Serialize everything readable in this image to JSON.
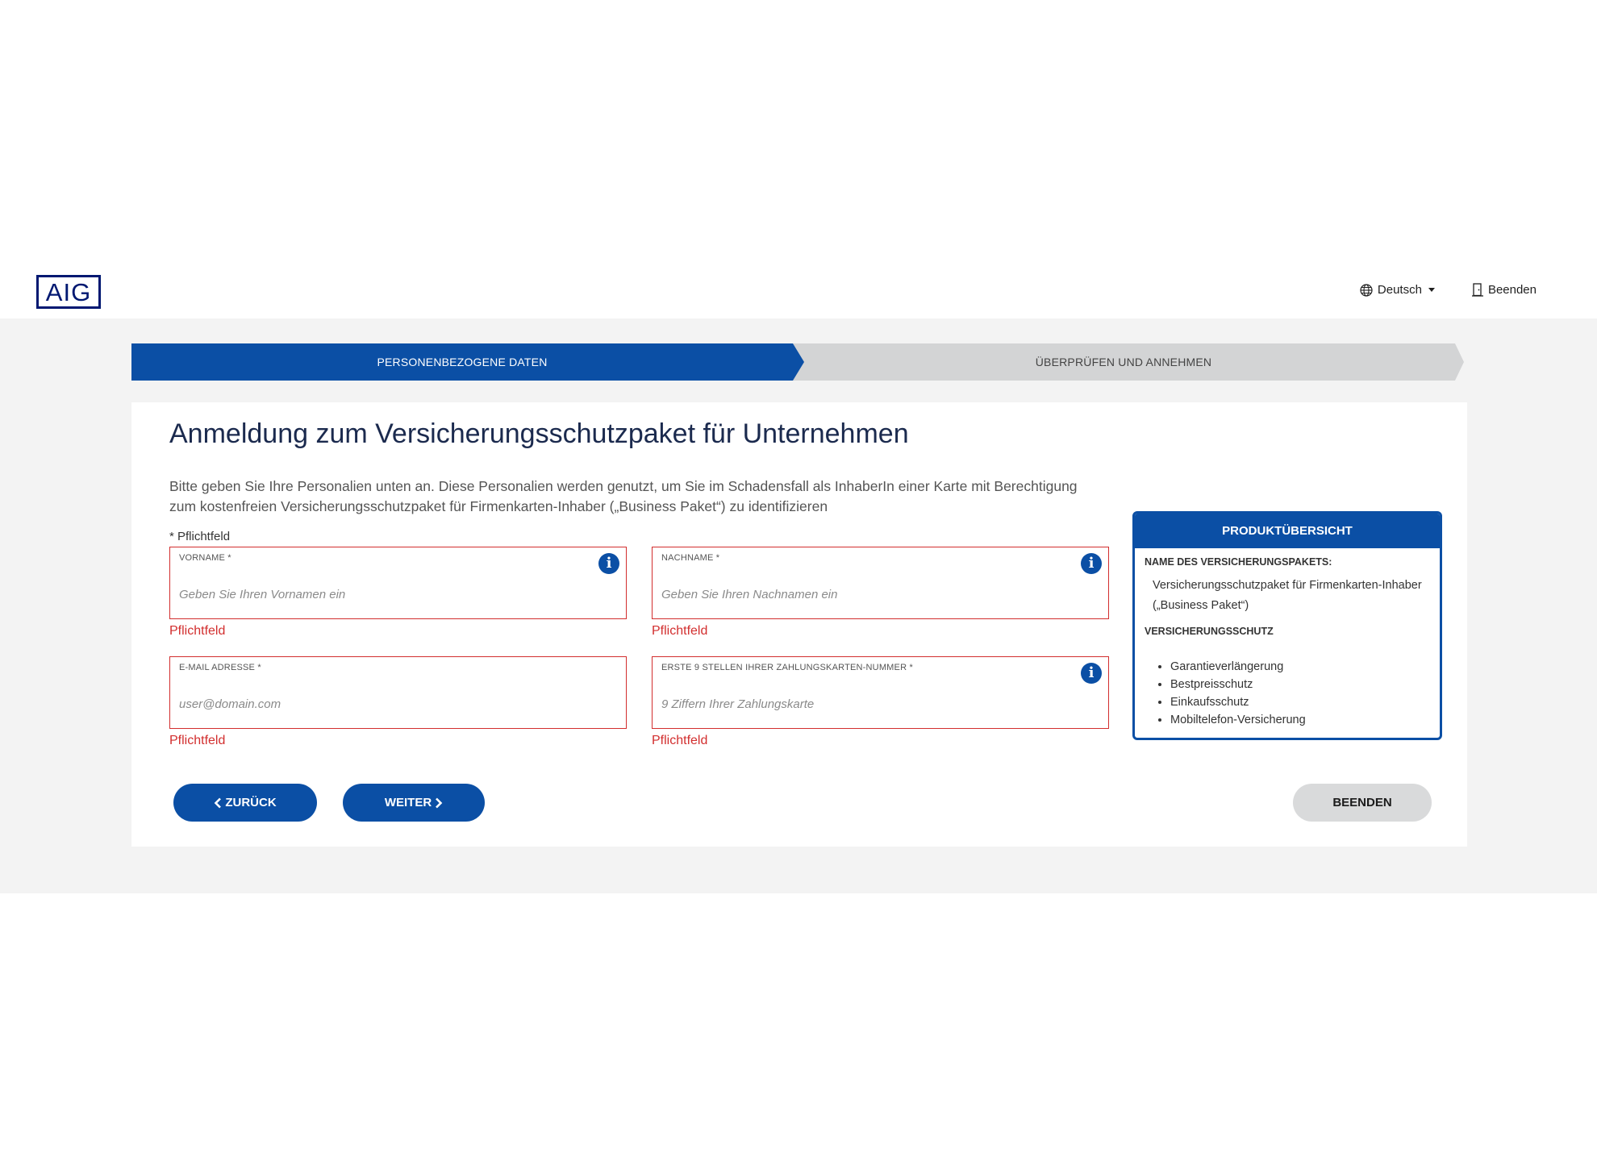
{
  "header": {
    "logo": "AIG",
    "language": "Deutsch",
    "exit": "Beenden"
  },
  "stepper": {
    "step1": "PERSONENBEZOGENE DATEN",
    "step2": "ÜBERPRÜFEN UND ANNEHMEN"
  },
  "form": {
    "title": "Anmeldung zum Versicherungsschutzpaket für Unternehmen",
    "intro": "Bitte geben Sie Ihre Personalien unten an. Diese Personalien werden genutzt, um Sie im Schadensfall als InhaberIn einer Karte mit Berechtigung zum kostenfreien Versicherungsschutzpaket für Firmenkarten-Inhaber („Business Paket“) zu identifizieren",
    "required_note": "* Pflichtfeld",
    "fields": {
      "firstname": {
        "label": "VORNAME *",
        "placeholder": "Geben Sie Ihren Vornamen ein",
        "value": "",
        "error": "Pflichtfeld"
      },
      "lastname": {
        "label": "NACHNAME *",
        "placeholder": "Geben Sie Ihren Nachnamen ein",
        "value": "",
        "error": "Pflichtfeld"
      },
      "email": {
        "label": "E-MAIL ADRESSE *",
        "placeholder": "user@domain.com",
        "value": "",
        "error": "Pflichtfeld"
      },
      "card": {
        "label": "ERSTE 9 STELLEN IHRER ZAHLUNGSKARTEN-NUMMER *",
        "placeholder": "9 Ziffern Ihrer Zahlungskarte",
        "value": "",
        "error": "Pflichtfeld"
      }
    },
    "buttons": {
      "back": "ZURÜCK",
      "next": "WEITER",
      "finish": "BEENDEN"
    }
  },
  "overview": {
    "heading": "PRODUKTÜBERSICHT",
    "package_label": "NAME DES VERSICHERUNGSPAKETS:",
    "package_name": "Versicherungsschutzpaket für Firmenkarten-Inhaber („Business Paket“)",
    "coverage_label": "VERSICHERUNGSSCHUTZ",
    "coverage_items": [
      "Garantieverlängerung",
      "Bestpreisschutz",
      "Einkaufsschutz",
      "Mobiltelefon-Versicherung"
    ]
  },
  "colors": {
    "primary": "#0b4fa5",
    "error": "#d22e2e",
    "brand_navy": "#001871",
    "band": "#f3f3f3"
  }
}
